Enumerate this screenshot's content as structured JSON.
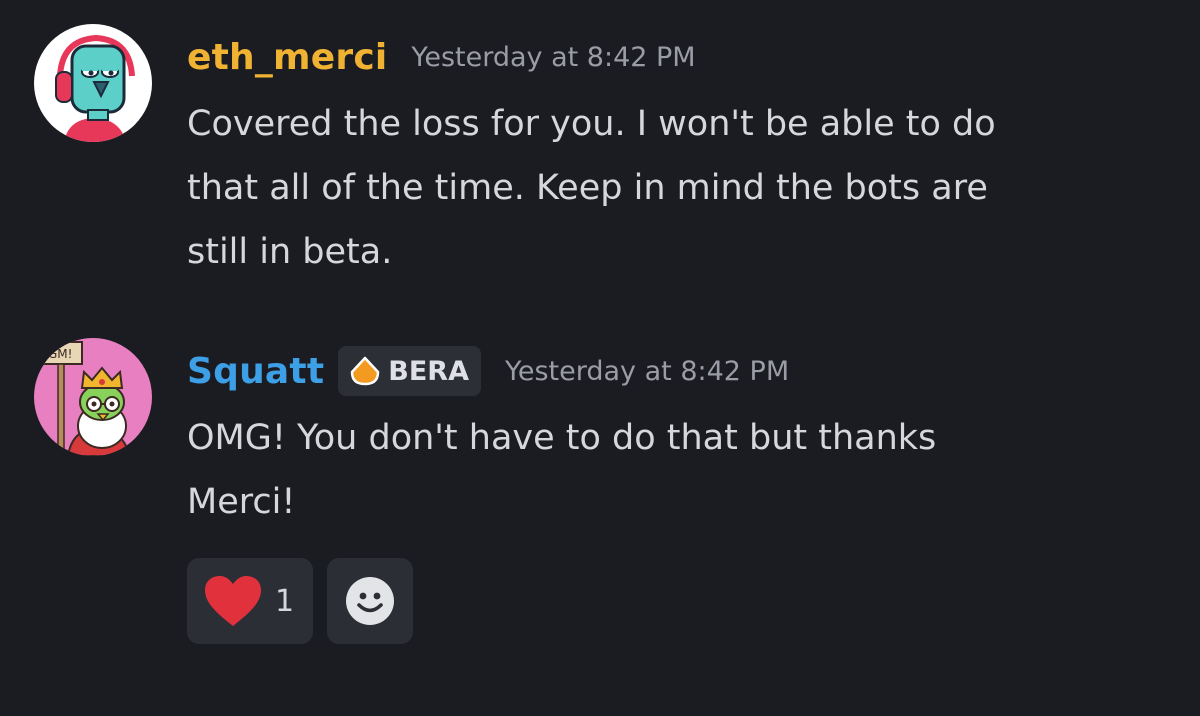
{
  "messages": [
    {
      "author": "eth_merci",
      "author_color": "#f0b232",
      "timestamp": "Yesterday at 8:42 PM",
      "avatar": "robot-avatar-icon",
      "lines": [
        "Covered the loss for you. I won't be able to do",
        "that all of the time. Keep in mind the bots are",
        "still in beta."
      ]
    },
    {
      "author": "Squatt",
      "author_color": "#3d9fe6",
      "tag": {
        "label": "BERA",
        "icon": "bera-drop-icon"
      },
      "timestamp": "Yesterday at 8:42 PM",
      "avatar": "frog-king-avatar-icon",
      "avatar_sign": "GM!",
      "lines": [
        "OMG! You don't have to do that but thanks",
        "Merci!"
      ],
      "reactions": [
        {
          "emoji": "heart-icon",
          "count": "1",
          "color": "#e0313c"
        },
        {
          "emoji": "add-reaction-smile-icon"
        }
      ]
    }
  ]
}
